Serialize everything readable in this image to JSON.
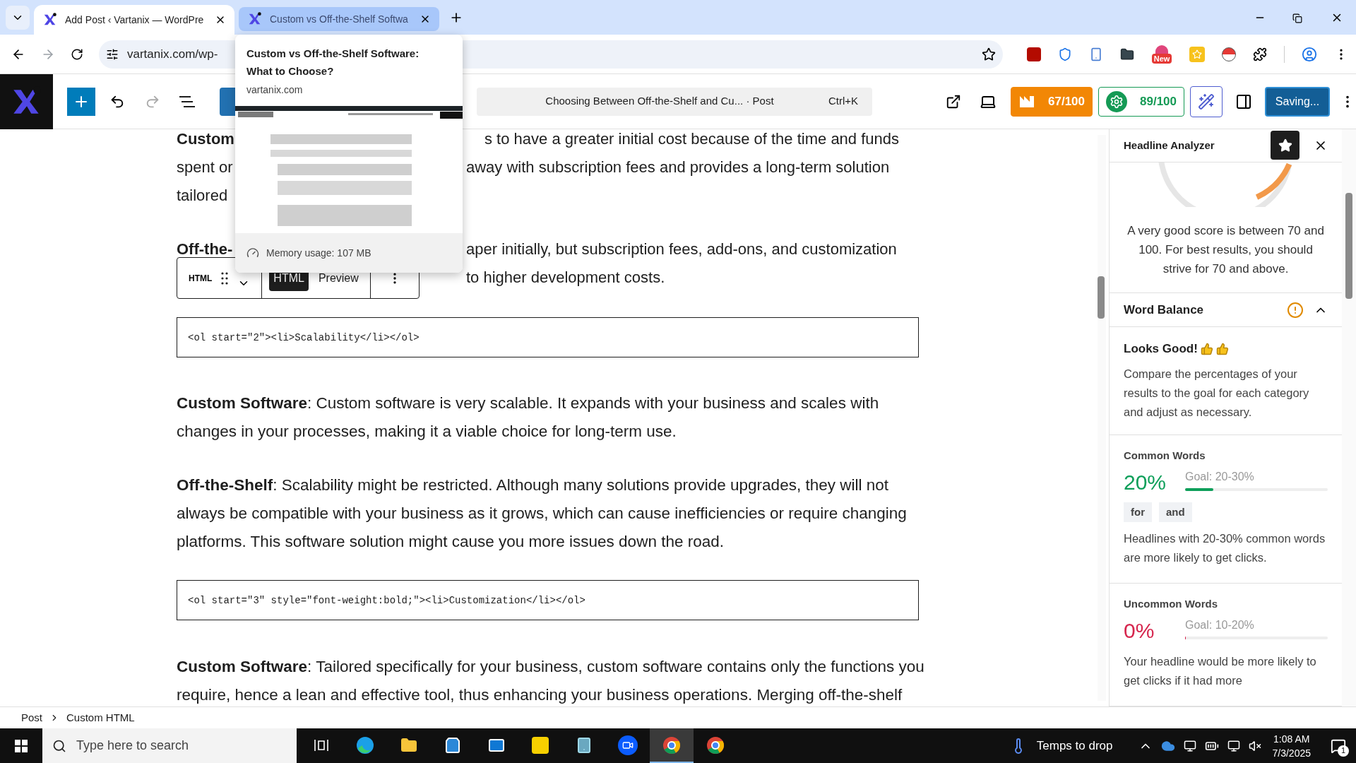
{
  "browser": {
    "tabs": [
      {
        "title": "Add Post ‹ Vartanix — WordPre",
        "selected": true
      },
      {
        "title": "Custom vs Off-the-Shelf Softwa",
        "selected": false
      }
    ],
    "address": "vartanix.com/wp-",
    "extension_badge": "New"
  },
  "tab_preview": {
    "title": "Custom vs Off-the-Shelf Software: What to Choose?",
    "domain": "vartanix.com",
    "memory": "Memory usage: 107 MB"
  },
  "editor_toolbar": {
    "command_title": "Choosing Between Off-the-Shelf and Cu... · Post",
    "shortcut": "Ctrl+K",
    "scores": [
      {
        "kind": "seo",
        "text": "67/100"
      },
      {
        "kind": "readability",
        "text": "89/100"
      }
    ],
    "save_button": "Saving..."
  },
  "block_toolbar": {
    "label": "HTML",
    "modes": [
      {
        "label": "HTML",
        "selected": true
      },
      {
        "label": "Preview",
        "selected": false
      }
    ]
  },
  "content": [
    {
      "kind": "covered",
      "lines": [
        {
          "left": "Custom",
          "left_bold": true,
          "right": "s to have a greater initial cost because of the time and funds"
        },
        {
          "left": "spent or",
          "left_bold": false,
          "right": "away with subscription fees and provides a long-term solution"
        },
        {
          "left": "tailored",
          "left_bold": false
        }
      ]
    },
    {
      "kind": "covered",
      "lines": [
        {
          "left": "Off-the-",
          "left_bold": true,
          "right": "aper initially, but subscription fees, add-ons, and customization"
        },
        {
          "right": "to higher development costs."
        }
      ]
    },
    {
      "kind": "code",
      "text": "<ol start=\"2\"><li>Scalability</li></ol>"
    },
    {
      "kind": "paragraph",
      "text": "**Custom Software**: Custom software is very scalable. It expands with your business and scales with changes in your processes, making it a viable choice for long-term use."
    },
    {
      "kind": "paragraph",
      "text": "**Off-the-Shelf**: Scalability might be restricted. Although many solutions provide upgrades, they will not always be compatible with your business as it grows, which can cause inefficiencies or require changing platforms. This software solution might cause you more issues down the road."
    },
    {
      "kind": "code",
      "text": "<ol start=\"3\" style=\"font-weight:bold;\"><li>Customization</li></ol>"
    },
    {
      "kind": "paragraph",
      "text": "**Custom Software**: Tailored specifically for your business, custom software contains only the functions you require, hence a lean and effective tool, thus enhancing your business operations. Merging off-the-shelf"
    }
  ],
  "breadcrumb": [
    "Post",
    "Custom HTML"
  ],
  "sidebar": {
    "title": "Headline Analyzer",
    "score_note": "A very good score is between 70 and 100. For best results, you should strive for 70 and above.",
    "section": {
      "title": "Word Balance",
      "expanded": true
    },
    "verdict": "Looks Good!",
    "intro": "Compare the percentages of your results to the goal for each category and adjust as necessary.",
    "categories": [
      {
        "name": "Common Words",
        "percent": "20%",
        "color": "#0e9f5a",
        "goal": "Goal: 20-30%",
        "level": 0.2,
        "tags": [
          "for",
          "and"
        ],
        "note": "Headlines with 20-30% common words are more likely to get clicks."
      },
      {
        "name": "Uncommon Words",
        "percent": "0%",
        "color": "#d6254d",
        "goal": "Goal: 10-20%",
        "level": 0,
        "note": "Your headline would be more likely to get clicks if it had more"
      }
    ]
  },
  "taskbar": {
    "search_placeholder": "Type here to search",
    "apps": [
      {
        "kind": "taskview",
        "active": false
      },
      {
        "kind": "browser",
        "active": false
      },
      {
        "kind": "folder",
        "active": false
      },
      {
        "kind": "store",
        "active": false
      },
      {
        "kind": "mail",
        "active": false
      },
      {
        "kind": "notes",
        "active": false
      },
      {
        "kind": "tablet",
        "active": false
      },
      {
        "kind": "video",
        "active": false
      },
      {
        "kind": "chrome",
        "active": true
      },
      {
        "kind": "chrome",
        "active": false
      }
    ],
    "weather": "Temps to drop",
    "time": "1:08 AM",
    "date": "7/3/2025",
    "notifications": "1"
  }
}
